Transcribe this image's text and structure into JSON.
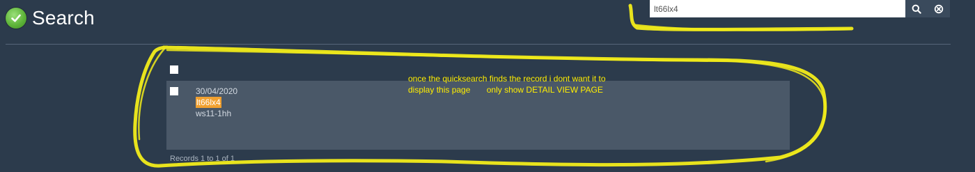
{
  "header": {
    "title": "Search",
    "icon": "check-circle-icon",
    "icon_color": "#5fb53a"
  },
  "quicksearch": {
    "value": "lt66lx4",
    "search_icon": "search-icon",
    "clear_icon": "clear-circle-icon"
  },
  "results": {
    "rows": [
      {
        "date": "30/04/2020",
        "reference": "lt66lx4",
        "postcode": "ws11-1hh"
      }
    ],
    "footer": "Records 1 to 1 of 1"
  },
  "annotation": {
    "line1": "once the quicksearch finds the record i dont want it to",
    "line2": "display this page       only show DETAIL VIEW PAGE",
    "color": "#ffee00"
  },
  "colors": {
    "background": "#2c3b4c",
    "panel": "#4a5868",
    "highlight": "#f0a030"
  }
}
